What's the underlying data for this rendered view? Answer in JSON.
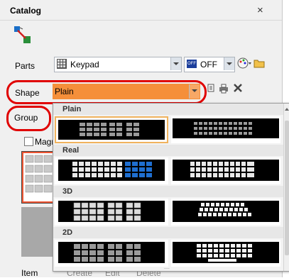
{
  "window": {
    "title": "Catalog",
    "close_label": "×"
  },
  "labels": {
    "parts": "Parts",
    "shape": "Shape",
    "group": "Group",
    "magnify": "Magn"
  },
  "parts_combo": {
    "value": "Keypad"
  },
  "state_combo": {
    "value": "OFF",
    "badge": "OFF"
  },
  "shape_combo": {
    "value": "Plain"
  },
  "popup": {
    "categories": [
      "Plain",
      "Real",
      "3D",
      "2D"
    ],
    "resize_grip": "...."
  },
  "bottom_bar": {
    "item": "Item",
    "create": "Create",
    "edit": "Edit",
    "delete": "Delete"
  },
  "colors": {
    "accent_orange": "#f58f3a",
    "highlight_red": "#e00000",
    "selection_orange": "#f0b35e"
  }
}
